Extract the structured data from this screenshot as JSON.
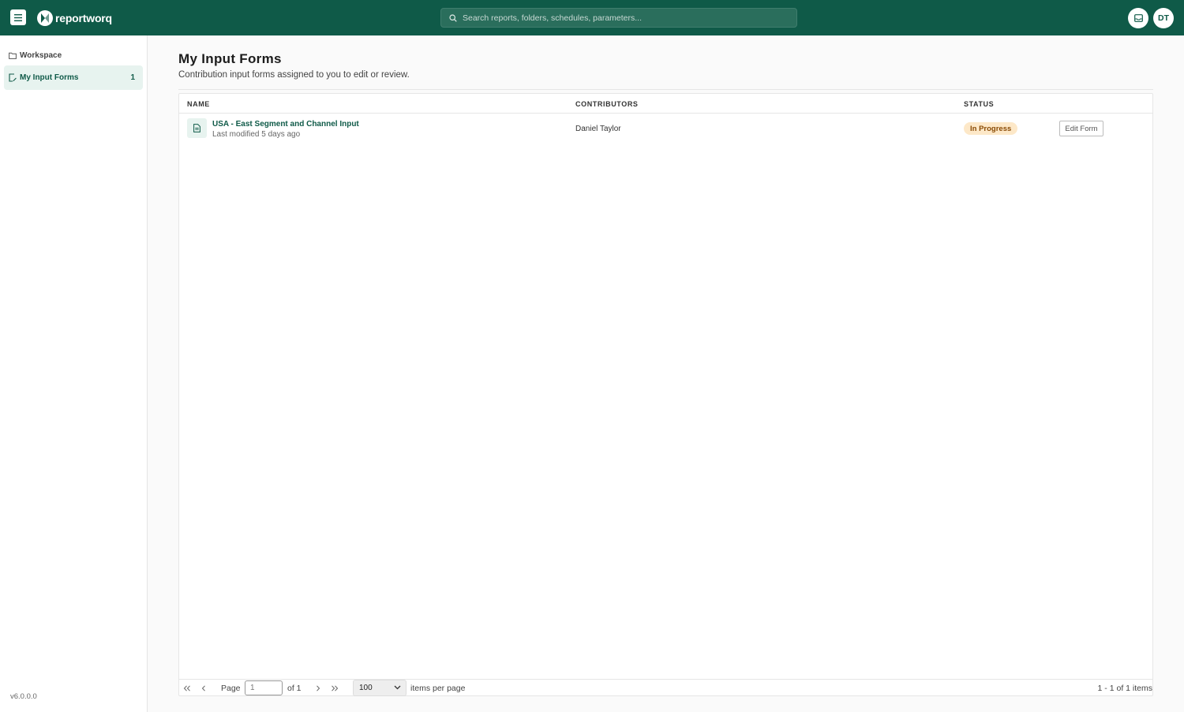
{
  "app": {
    "name": "reportworq",
    "brand_color": "#0f5a48"
  },
  "header": {
    "search_placeholder": "Search reports, folders, schedules, parameters...",
    "user_initials": "DT"
  },
  "sidebar": {
    "section_label": "Workspace",
    "items": [
      {
        "label": "My Input Forms",
        "count": "1",
        "icon": "edit-document-icon"
      }
    ],
    "version": "v6.0.0.0"
  },
  "main": {
    "title": "My Input Forms",
    "subtitle": "Contribution input forms assigned to you to edit or review.",
    "columns": [
      "NAME",
      "CONTRIBUTORS",
      "STATUS"
    ],
    "rows": [
      {
        "name": "USA - East Segment and Channel Input",
        "meta": "Last modified 5 days ago",
        "contributors": "Daniel Taylor",
        "status": "In Progress",
        "action_label": "Edit Form"
      }
    ]
  },
  "pager": {
    "page_label": "Page",
    "page_value": "1",
    "of_label": "of 1",
    "page_size": "100",
    "per_page_label": "items per page",
    "total": "1 - 1 of 1 items"
  }
}
